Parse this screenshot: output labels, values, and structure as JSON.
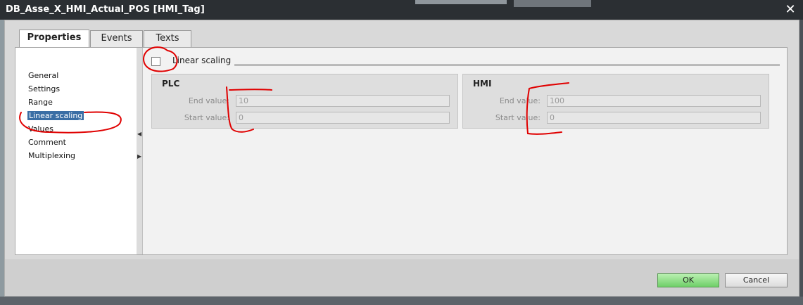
{
  "window": {
    "title": "DB_Asse_X_HMI_Actual_POS [HMI_Tag]",
    "close_glyph": "✕"
  },
  "tabs": [
    {
      "label": "Properties",
      "active": true
    },
    {
      "label": "Events",
      "active": false
    },
    {
      "label": "Texts",
      "active": false
    }
  ],
  "nav": {
    "items": [
      {
        "label": "General"
      },
      {
        "label": "Settings"
      },
      {
        "label": "Range"
      },
      {
        "label": "Linear scaling",
        "selected": true
      },
      {
        "label": "Values"
      },
      {
        "label": "Comment"
      },
      {
        "label": "Multiplexing"
      }
    ]
  },
  "section": {
    "checkbox_label": "Linear scaling",
    "checked": false
  },
  "plc": {
    "title": "PLC",
    "end_label": "End value:",
    "end_value": "10",
    "start_label": "Start value:",
    "start_value": "0"
  },
  "hmi": {
    "title": "HMI",
    "end_label": "End value:",
    "end_value": "100",
    "start_label": "Start value:",
    "start_value": "0"
  },
  "buttons": {
    "ok": "OK",
    "cancel": "Cancel"
  },
  "colors": {
    "selection": "#3a6ea5",
    "ok_button": "#6fcf68",
    "annotation_ink": "#e00000"
  },
  "icons": {
    "splitter_left": "arrow-left-icon",
    "splitter_right": "arrow-right-icon",
    "close": "close-icon"
  }
}
